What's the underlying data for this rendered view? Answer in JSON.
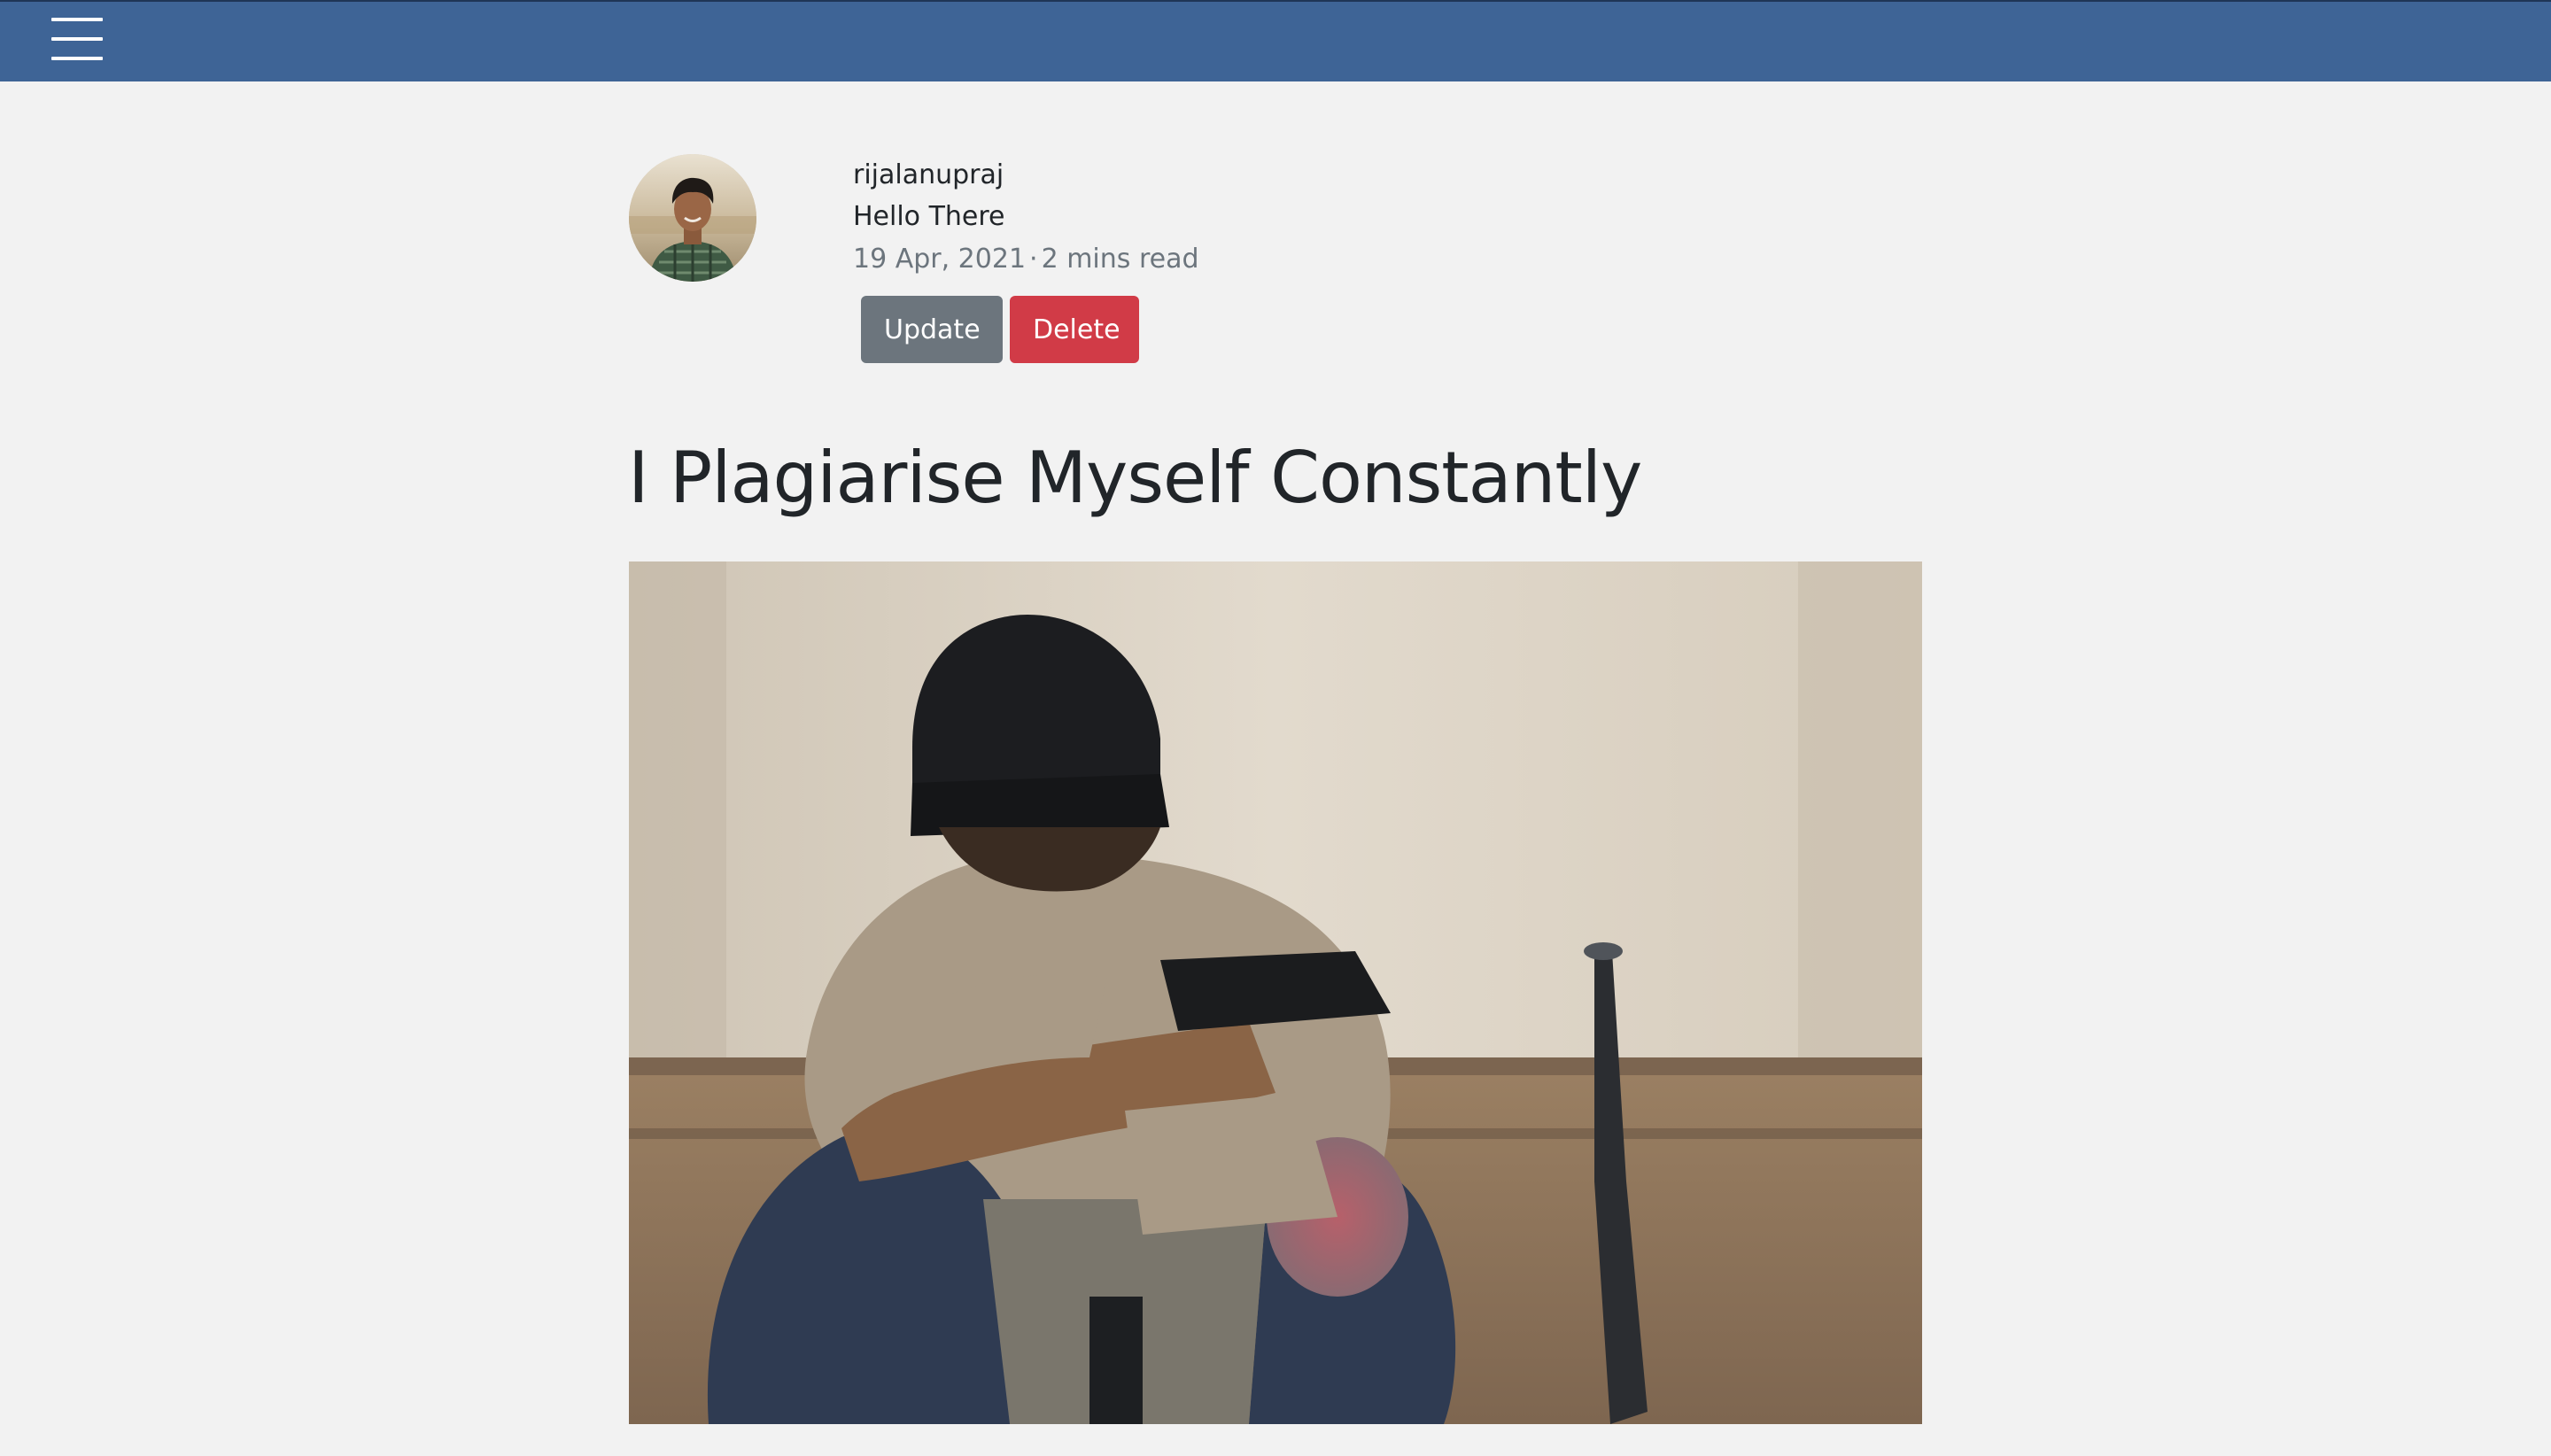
{
  "navbar": {
    "menu_icon": "hamburger-menu-icon",
    "background_color": "#3e6496"
  },
  "author": {
    "username": "rijalanupraj",
    "bio": "Hello There",
    "avatar_icon": "user-avatar-photo"
  },
  "post": {
    "date": "19 Apr, 2021",
    "separator": "·",
    "read_time": "2 mins read",
    "title": "I Plagiarise Myself Constantly",
    "cover_image": "cover-photo"
  },
  "actions": {
    "update_label": "Update",
    "delete_label": "Delete",
    "update_color": "#6c757d",
    "delete_color": "#d13b47"
  }
}
